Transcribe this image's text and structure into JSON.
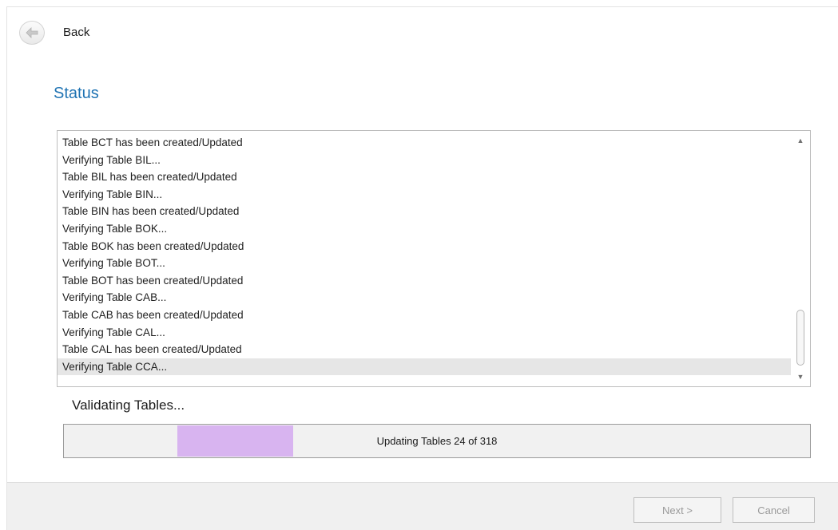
{
  "header": {
    "back_label": "Back"
  },
  "page": {
    "title": "Status"
  },
  "log": {
    "lines": [
      "Table BCT has been created/Updated",
      "Verifying Table BIL...",
      "Table BIL has been created/Updated",
      "Verifying Table BIN...",
      "Table BIN has been created/Updated",
      "Verifying Table BOK...",
      "Table BOK has been created/Updated",
      "Verifying Table BOT...",
      "Table BOT has been created/Updated",
      "Verifying Table CAB...",
      "Table CAB has been created/Updated",
      "Verifying Table CAL...",
      "Table CAL has been created/Updated",
      "Verifying Table CCA..."
    ],
    "selected_index": 13
  },
  "progress": {
    "status_label": "Validating Tables...",
    "text": "Updating Tables 24 of 318",
    "fill_color": "#d8b4f0"
  },
  "footer": {
    "next_label": "Next >",
    "cancel_label": "Cancel"
  },
  "icons": {
    "back": "back-arrow-icon",
    "scroll_up": "scroll-up-icon",
    "scroll_down": "scroll-down-icon"
  },
  "colors": {
    "title": "#1f73b3",
    "selected_row": "#e6e6e6"
  }
}
